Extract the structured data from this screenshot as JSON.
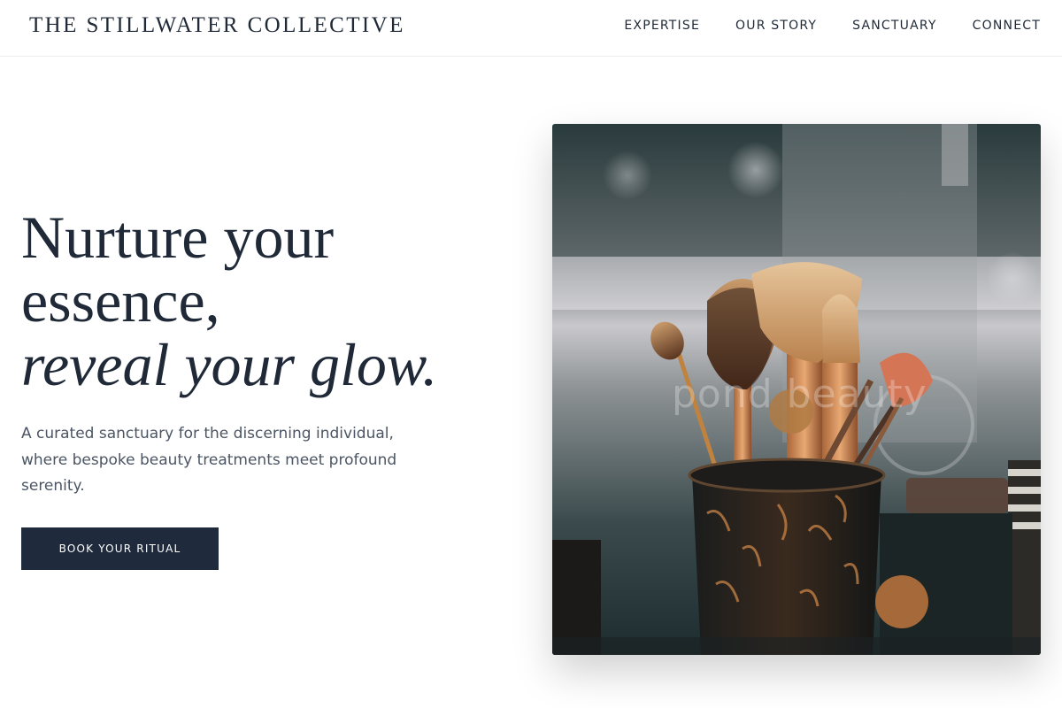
{
  "header": {
    "brand": "THE STILLWATER COLLECTIVE",
    "nav": [
      {
        "label": "EXPERTISE"
      },
      {
        "label": "OUR STORY"
      },
      {
        "label": "SANCTUARY"
      },
      {
        "label": "CONNECT"
      }
    ]
  },
  "hero": {
    "headline_line1": "Nurture your",
    "headline_line2": "essence,",
    "headline_line3": "reveal your glow.",
    "description": "A curated sanctuary for the discerning individual, where bespoke beauty treatments meet profound serenity.",
    "cta_label": "BOOK YOUR RITUAL",
    "image": {
      "subject": "makeup brushes in a dark cup on a vanity",
      "watermark": "pond beauty"
    }
  },
  "colors": {
    "text_primary": "#1f2937",
    "text_secondary": "#4b5563",
    "button_bg": "#1f2a3d",
    "button_text": "#ffffff",
    "background": "#ffffff"
  }
}
